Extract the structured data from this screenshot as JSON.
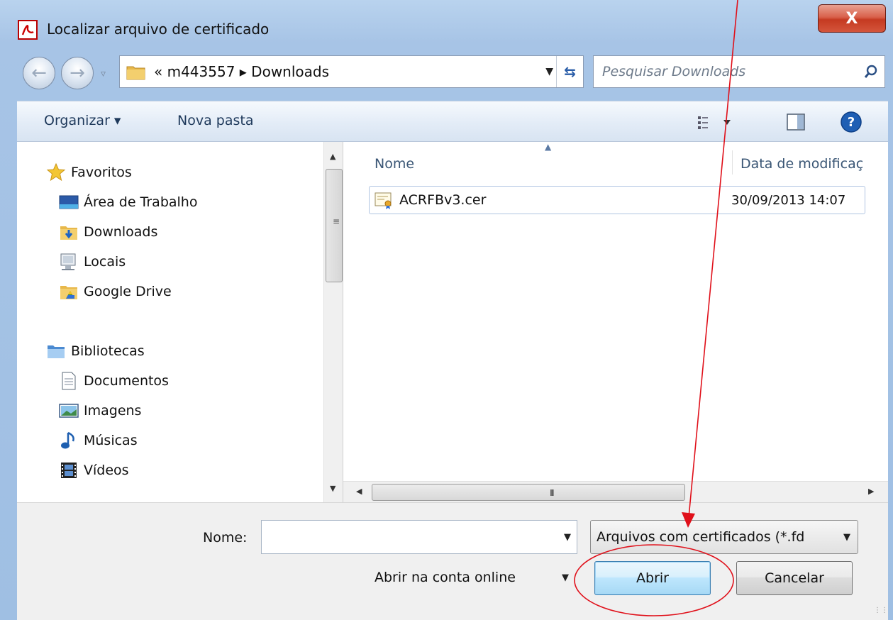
{
  "window": {
    "title": "Localizar arquivo de certificado",
    "close_label": "X"
  },
  "address": {
    "path": "« m443557 ▸ Downloads",
    "search_placeholder": "Pesquisar Downloads"
  },
  "toolbar": {
    "organize_label": "Organizar ▾",
    "new_folder_label": "Nova pasta"
  },
  "navigation": {
    "favorites_header": "Favoritos",
    "favorites": [
      {
        "label": "Área de Trabalho",
        "icon": "desktop-icon"
      },
      {
        "label": "Downloads",
        "icon": "downloads-folder-icon"
      },
      {
        "label": "Locais",
        "icon": "recent-places-icon"
      },
      {
        "label": "Google Drive",
        "icon": "google-drive-folder-icon"
      }
    ],
    "libraries_header": "Bibliotecas",
    "libraries": [
      {
        "label": "Documentos",
        "icon": "documents-icon"
      },
      {
        "label": "Imagens",
        "icon": "pictures-icon"
      },
      {
        "label": "Músicas",
        "icon": "music-icon"
      },
      {
        "label": "Vídeos",
        "icon": "videos-icon"
      }
    ]
  },
  "files": {
    "columns": {
      "name": "Nome",
      "date": "Data de modificaç"
    },
    "rows": [
      {
        "name": "ACRFBv3.cer",
        "modified": "30/09/2013 14:07",
        "icon": "certificate-icon"
      }
    ],
    "hscroll_grip": "III",
    "vscroll_grip": "≡"
  },
  "footer": {
    "name_label": "Nome:",
    "name_value": "",
    "filter_value": "Arquivos com certificados (*.fd",
    "open_online_label": "Abrir na conta online",
    "open_button": "Abrir",
    "cancel_button": "Cancelar"
  },
  "colors": {
    "annotation_red": "#e0101a",
    "accent_blue": "#3c7fb1",
    "window_frame": "#a7c4e6"
  }
}
